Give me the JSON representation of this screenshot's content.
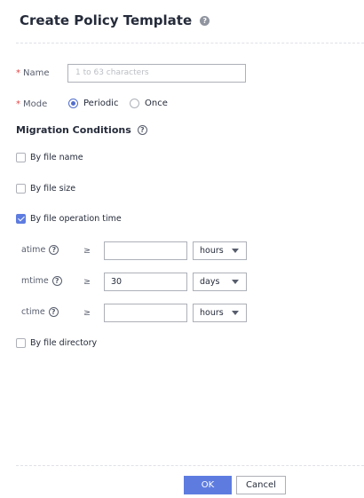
{
  "dialog": {
    "title": "Create Policy Template",
    "help_glyph": "?"
  },
  "form": {
    "name": {
      "required_mark": "*",
      "label": "Name",
      "placeholder": "1 to 63 characters",
      "value": ""
    },
    "mode": {
      "required_mark": "*",
      "label": "Mode",
      "options": [
        {
          "label": "Periodic",
          "selected": true
        },
        {
          "label": "Once",
          "selected": false
        }
      ]
    }
  },
  "migration": {
    "title": "Migration Conditions",
    "conditions": [
      {
        "label": "By file name",
        "checked": false
      },
      {
        "label": "By file size",
        "checked": false
      },
      {
        "label": "By file operation time",
        "checked": true
      },
      {
        "label": "By file directory",
        "checked": false
      }
    ],
    "operator": "≥",
    "times": [
      {
        "label": "atime",
        "value": "",
        "unit": "hours"
      },
      {
        "label": "mtime",
        "value": "30",
        "unit": "days"
      },
      {
        "label": "ctime",
        "value": "",
        "unit": "hours"
      }
    ]
  },
  "footer": {
    "ok_label": "OK",
    "cancel_label": "Cancel"
  },
  "colors": {
    "accent": "#5e7ce0",
    "required": "#e54545"
  },
  "icons": {
    "title_help": "question-circle-filled-icon",
    "field_help": "question-circle-outline-icon",
    "select_caret": "caret-down-icon"
  }
}
